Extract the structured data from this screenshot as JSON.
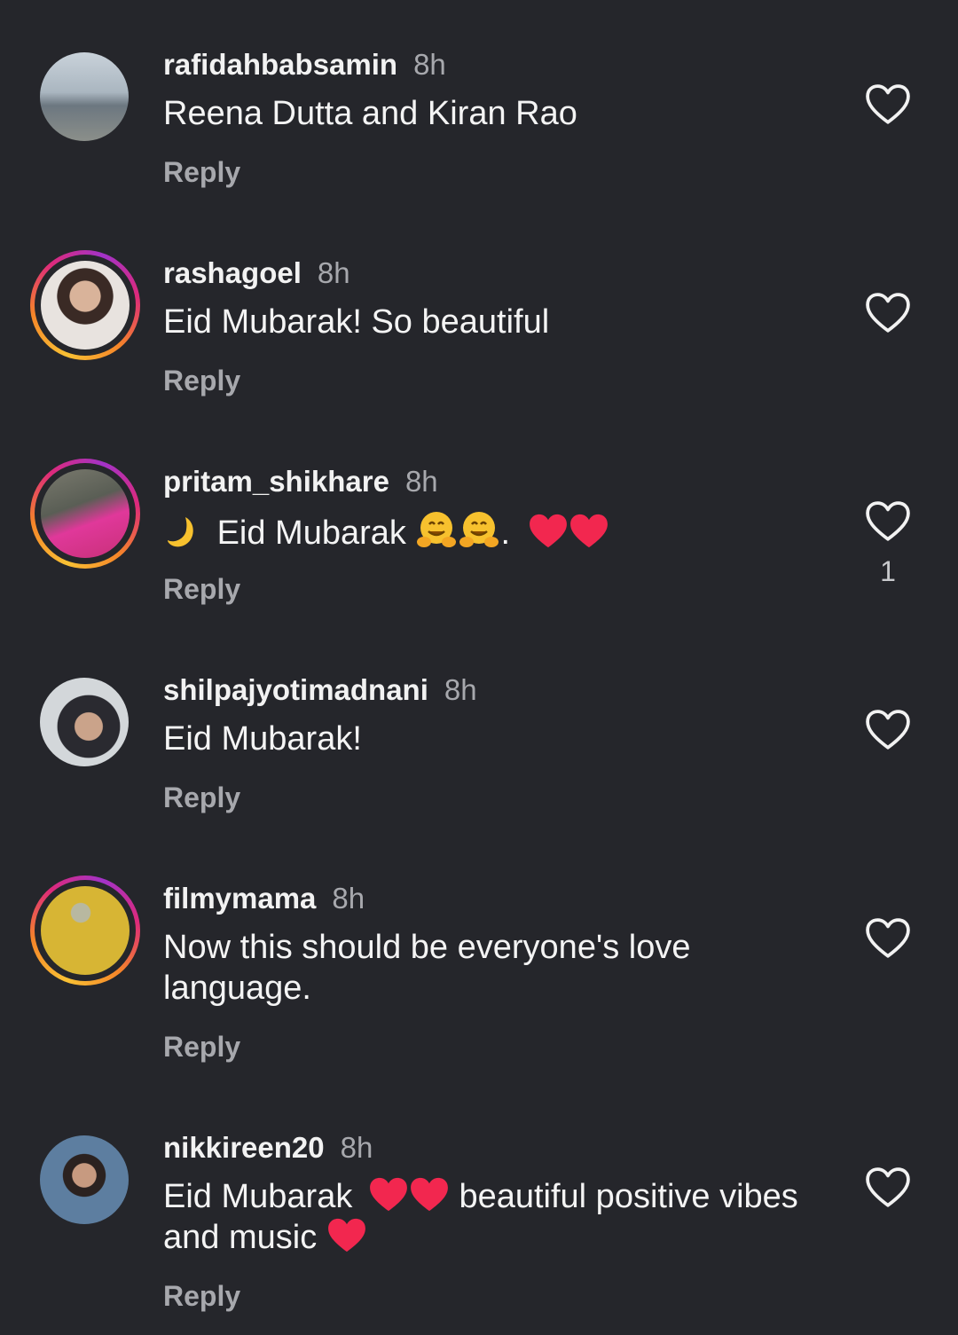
{
  "comments": [
    {
      "username": "rafidahbabsamin",
      "time": "8h",
      "text": "Reena Dutta and Kiran Rao",
      "reply": "Reply",
      "like_count": ""
    },
    {
      "username": "rashagoel",
      "time": "8h",
      "text": "Eid Mubarak! So beautiful",
      "reply": "Reply",
      "like_count": ""
    },
    {
      "username": "pritam_shikhare",
      "time": "8h",
      "text_prefix": "Eid Mubarak",
      "text_suffix": ".",
      "reply": "Reply",
      "like_count": "1"
    },
    {
      "username": "shilpajyotimadnani",
      "time": "8h",
      "text": "Eid Mubarak!",
      "reply": "Reply",
      "like_count": ""
    },
    {
      "username": "filmymama",
      "time": "8h",
      "text": "Now this should be everyone's love language.",
      "reply": "Reply",
      "like_count": ""
    },
    {
      "username": "nikkireen20",
      "time": "8h",
      "text_part1": "Eid Mubarak",
      "text_part2": "beautiful positive vibes and music",
      "reply": "Reply",
      "like_count": ""
    }
  ],
  "icons": {
    "like": "heart-outline-icon",
    "emoji_moon": "crescent-moon-icon",
    "emoji_hug": "hugging-face-icon",
    "emoji_heart": "red-heart-icon"
  },
  "colors": {
    "background": "#25262b",
    "secondary_text": "#a7a8ad",
    "heart_emoji": "#f2274f"
  }
}
